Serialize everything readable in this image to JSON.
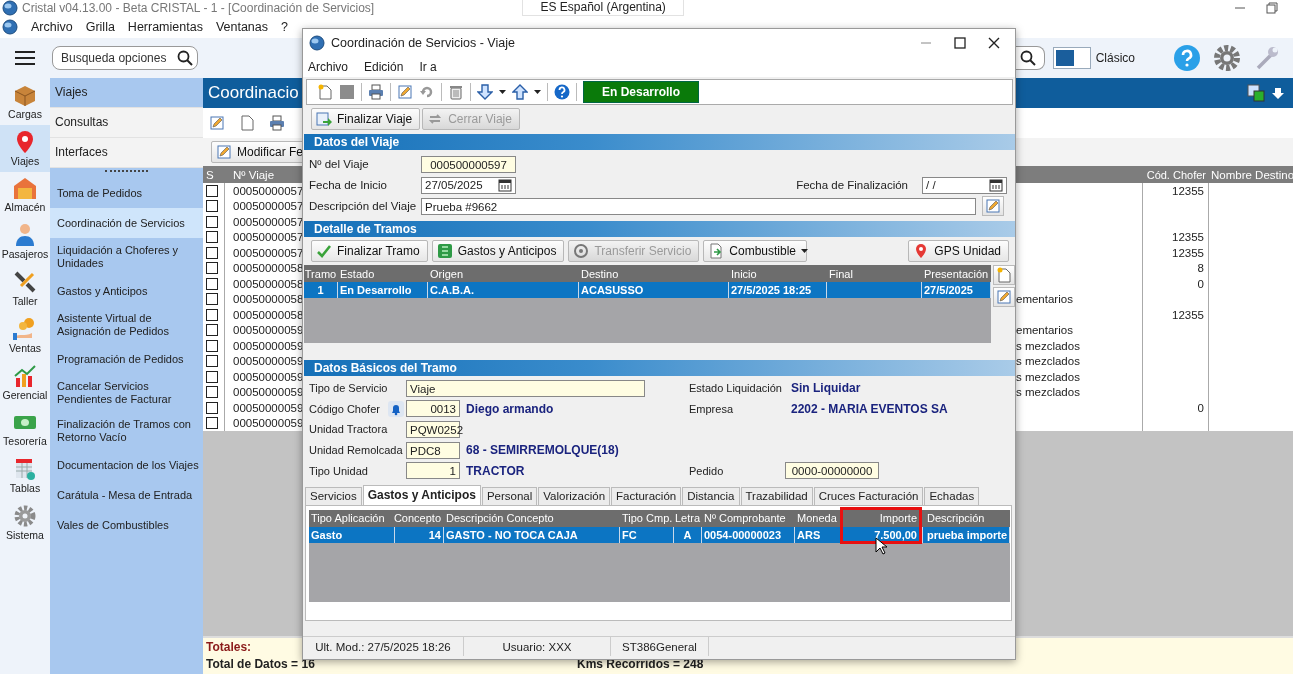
{
  "window": {
    "title": "Cristal v04.13.00 - Beta CRISTAL - 1 - [Coordinación de Servicios]",
    "language": "ES Español (Argentina)"
  },
  "menu": [
    "Archivo",
    "Grilla",
    "Herramientas",
    "Ventanas",
    "?"
  ],
  "modules": [
    {
      "label": "Cargas",
      "selected": false
    },
    {
      "label": "Viajes",
      "selected": true
    },
    {
      "label": "Almacén",
      "selected": false
    },
    {
      "label": "Pasajeros",
      "selected": false
    },
    {
      "label": "Taller",
      "selected": false
    },
    {
      "label": "Ventas",
      "selected": false
    },
    {
      "label": "Gerencial",
      "selected": false
    },
    {
      "label": "Tesorería",
      "selected": false
    },
    {
      "label": "Tablas",
      "selected": false
    },
    {
      "label": "Sistema",
      "selected": false
    }
  ],
  "search": {
    "placeholder": "Busqueda opciones"
  },
  "theme": {
    "label": "Clásico"
  },
  "sections": [
    {
      "label": "Viajes",
      "selected": true
    },
    {
      "label": "Consultas",
      "selected": false
    },
    {
      "label": "Interfaces",
      "selected": false
    }
  ],
  "submenu": [
    {
      "label": "Toma de Pedidos",
      "selected": false
    },
    {
      "label": "Coordinación de Servicios",
      "selected": true
    },
    {
      "label": "Liquidación a Choferes y Unidades",
      "selected": false
    },
    {
      "label": "Gastos y Anticipos",
      "selected": false
    },
    {
      "label": "Asistente Virtual de Asignación de Pedidos",
      "selected": false
    },
    {
      "label": "Programación de Pedidos",
      "selected": false
    },
    {
      "label": "Cancelar Servicios Pendientes de Facturar",
      "selected": false
    },
    {
      "label": "Finalización de Tramos con Retorno Vacío",
      "selected": false
    },
    {
      "label": "Documentacion de los Viajes",
      "selected": false
    },
    {
      "label": "Carátula - Mesa de Entrada",
      "selected": false
    },
    {
      "label": "Vales de Combustibles",
      "selected": false
    }
  ],
  "page": {
    "title": "Coordinacio",
    "toolbar_button": "Modificar Fe"
  },
  "table": {
    "columns": [
      "S",
      "Nº Viaje",
      "Cód. Chofer",
      "Nombre Destino"
    ],
    "rows": [
      {
        "checked": false,
        "trip": "00050000057",
        "driver_code": "12355"
      },
      {
        "checked": false,
        "trip": "00050000057"
      },
      {
        "checked": false,
        "trip": "00050000057"
      },
      {
        "checked": false,
        "trip": "00050000057",
        "driver_code": "12355"
      },
      {
        "checked": false,
        "trip": "00050000057",
        "driver_code": "12355"
      },
      {
        "checked": false,
        "trip": "00050000058",
        "driver_code": "8"
      },
      {
        "checked": false,
        "trip": "00050000058",
        "driver_code": "0"
      },
      {
        "checked": false,
        "trip": "00050000058",
        "column_3": "ementarios"
      },
      {
        "checked": false,
        "trip": "00050000058",
        "driver_code": "12355"
      },
      {
        "checked": false,
        "trip": "00050000059",
        "column_3": "ementarios"
      },
      {
        "checked": false,
        "trip": "00050000059",
        "column_3": "s mezclados"
      },
      {
        "checked": false,
        "trip": "00050000059",
        "column_3": "s mezclados"
      },
      {
        "checked": false,
        "trip": "00050000059",
        "column_3": "s mezclados"
      },
      {
        "checked": false,
        "trip": "00050000059",
        "column_3": "s mezclados"
      },
      {
        "checked": false,
        "trip": "00050000059",
        "driver_code": "0"
      },
      {
        "checked": false,
        "trip": "00050000059"
      }
    ]
  },
  "totals": {
    "label": "Totales:",
    "count": "Total de Datos = 16",
    "kms": "Kms Recorridos = 248"
  },
  "dialog": {
    "title": "Coordinación de Servicios - Viaje",
    "menu": [
      "Archivo",
      "Edición",
      "Ir a"
    ],
    "status": "En Desarrollo",
    "actions": [
      {
        "label": "Finalizar Viaje",
        "disabled": false
      },
      {
        "label": "Cerrar Viaje",
        "disabled": true
      }
    ],
    "trip_section": "Datos del Viaje",
    "trip_number": {
      "label": "Nº del Viaje",
      "value": "000500000597"
    },
    "start_date": {
      "label": "Fecha de Inicio",
      "value": "27/05/2025"
    },
    "end_date": {
      "label": "Fecha de Finalización",
      "value": "/ /"
    },
    "description": {
      "label": "Descripción del Viaje",
      "value": "Prueba #9662"
    },
    "legs_section": "Detalle de Tramos",
    "leg_actions": [
      {
        "label": "Finalizar Tramo",
        "disabled": false
      },
      {
        "label": "Gastos y Anticipos",
        "disabled": false
      },
      {
        "label": "Transferir Servicio",
        "disabled": true
      },
      {
        "label": "Combustible",
        "disabled": false
      }
    ],
    "gps_button": "GPS Unidad",
    "legs": {
      "columns": [
        "Tramo",
        "Estado",
        "Origen",
        "Destino",
        "Inicio",
        "Final",
        "Presentación"
      ],
      "rows": [
        {
          "selected": true,
          "cells": [
            "1",
            "En Desarrollo",
            "C.A.B.A.",
            "ACASUSSO",
            "27/5/2025 18:25",
            null,
            "27/5/2025"
          ]
        }
      ]
    },
    "basic_section": "Datos Básicos del Tramo",
    "basic_rows": [
      {
        "label": "Tipo de Servicio",
        "value": "Viaje",
        "right": {
          "label": "Estado Liquidación",
          "value": "Sin Liquidar",
          "kind": "text"
        }
      },
      {
        "label": "Código Chofer",
        "value": "0013",
        "detail": "Diego armando",
        "right": {
          "label": "Empresa",
          "value": "2202 - MARIA EVENTOS SA",
          "kind": "text"
        }
      },
      {
        "label": "Unidad Tractora",
        "value": "PQW0252"
      },
      {
        "label": "Unidad Remolcada",
        "value": "PDC8",
        "detail": "68 - SEMIRREMOLQUE(18)"
      },
      {
        "label": "Tipo Unidad",
        "value": "1",
        "detail": "TRACTOR",
        "right": {
          "label": "Pedido",
          "value": "0000-00000000",
          "kind": "field"
        }
      }
    ],
    "tabs": [
      {
        "label": "Servicios",
        "selected": false
      },
      {
        "label": "Gastos y Anticipos",
        "selected": true
      },
      {
        "label": "Personal",
        "selected": false
      },
      {
        "label": "Valorización",
        "selected": false
      },
      {
        "label": "Facturación",
        "selected": false
      },
      {
        "label": "Distancia",
        "selected": false
      },
      {
        "label": "Trazabilidad",
        "selected": false
      },
      {
        "label": "Cruces Facturación",
        "selected": false
      },
      {
        "label": "Echadas",
        "selected": false
      }
    ],
    "expenses": {
      "columns": [
        "Tipo Aplicación",
        "Concepto",
        "Descripción Concepto",
        "Tipo Cmp.",
        "Letra",
        "Nº Comprobante",
        "Moneda",
        "Importe",
        "Descripción"
      ],
      "rows": [
        {
          "selected": true,
          "cells": [
            "Gasto",
            "14",
            "GASTO - NO TOCA CAJA",
            "FC",
            "A",
            "0054-00000023",
            "ARS",
            "7.500,00",
            "prueba importe"
          ]
        }
      ]
    },
    "status_bar": [
      "Ult. Mod.: 27/5/2025 18:26",
      "Usuario: XXX",
      "ST386General"
    ]
  }
}
